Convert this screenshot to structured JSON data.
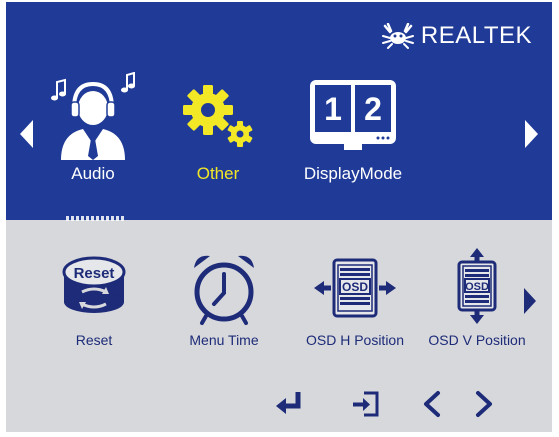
{
  "brand": {
    "name": "REALTEK",
    "logo_icon": "realtek-crab-logo"
  },
  "colors": {
    "panel_blue": "#203b97",
    "panel_grey": "#d7d8dc",
    "selected_text": "#f3e826",
    "icon_navy": "#1d2b78"
  },
  "main_menu": {
    "items": [
      {
        "label": "Audio",
        "icon": "headset-person-icon",
        "selected": false
      },
      {
        "label": "Other",
        "icon": "gears-icon",
        "selected": true
      },
      {
        "label": "DisplayMode",
        "icon": "display-mode-icon",
        "selected": false,
        "icon_text": [
          "1",
          "2"
        ]
      }
    ]
  },
  "sub_menu": {
    "items": [
      {
        "label": "Reset",
        "icon": "reset-icon",
        "icon_text": "Reset"
      },
      {
        "label": "Menu Time",
        "icon": "alarm-clock-icon"
      },
      {
        "label": "OSD H Position",
        "icon": "osd-horizontal-icon",
        "icon_text": "OSD"
      },
      {
        "label": "OSD V Position",
        "icon": "osd-vertical-icon",
        "icon_text": "OSD"
      }
    ]
  },
  "controls": [
    "enter-icon",
    "exit-icon",
    "chevron-left-icon",
    "chevron-right-icon"
  ]
}
